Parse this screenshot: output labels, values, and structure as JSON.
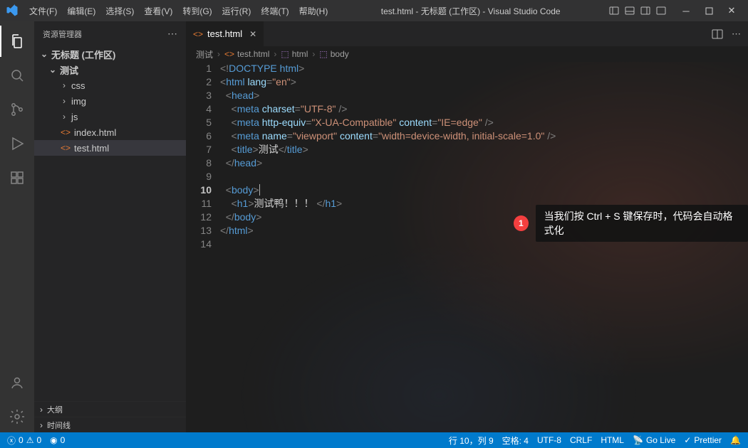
{
  "title": "test.html - 无标题 (工作区) - Visual Studio Code",
  "menu": [
    "文件(F)",
    "编辑(E)",
    "选择(S)",
    "查看(V)",
    "转到(G)",
    "运行(R)",
    "终端(T)",
    "帮助(H)"
  ],
  "sidebar": {
    "header": "资源管理器",
    "root": "无标题 (工作区)",
    "folder": "测试",
    "items": [
      {
        "kind": "folder",
        "label": "css"
      },
      {
        "kind": "folder",
        "label": "img"
      },
      {
        "kind": "folder",
        "label": "js"
      },
      {
        "kind": "file",
        "label": "index.html",
        "icon": "<>"
      },
      {
        "kind": "file",
        "label": "test.html",
        "icon": "<>",
        "selected": true
      }
    ],
    "outline": "大纲",
    "timeline": "时间线"
  },
  "tab": {
    "name": "test.html"
  },
  "breadcrumb": [
    "测试",
    "test.html",
    "html",
    "body"
  ],
  "code": {
    "lines": [
      {
        "n": 1,
        "seg": [
          [
            "<!",
            "tok-doctype"
          ],
          [
            "DOCTYPE ",
            "tok-doctype2"
          ],
          [
            "html",
            "tok-doctype2"
          ],
          [
            ">",
            "tok-doctype"
          ]
        ]
      },
      {
        "n": 2,
        "seg": [
          [
            "<",
            "tok-pun"
          ],
          [
            "html ",
            "tok-tag"
          ],
          [
            "lang",
            "tok-attr"
          ],
          [
            "=",
            "tok-pun"
          ],
          [
            "\"en\"",
            "tok-str"
          ],
          [
            ">",
            "tok-pun"
          ]
        ]
      },
      {
        "n": 3,
        "seg": [
          [
            "  <",
            "tok-pun"
          ],
          [
            "head",
            "tok-tag"
          ],
          [
            ">",
            "tok-pun"
          ]
        ]
      },
      {
        "n": 4,
        "seg": [
          [
            "    <",
            "tok-pun"
          ],
          [
            "meta ",
            "tok-tag"
          ],
          [
            "charset",
            "tok-attr"
          ],
          [
            "=",
            "tok-pun"
          ],
          [
            "\"UTF-8\"",
            "tok-str"
          ],
          [
            " />",
            "tok-pun"
          ]
        ]
      },
      {
        "n": 5,
        "seg": [
          [
            "    <",
            "tok-pun"
          ],
          [
            "meta ",
            "tok-tag"
          ],
          [
            "http-equiv",
            "tok-attr"
          ],
          [
            "=",
            "tok-pun"
          ],
          [
            "\"X-UA-Compatible\"",
            "tok-str"
          ],
          [
            " ",
            "tok-txt"
          ],
          [
            "content",
            "tok-attr"
          ],
          [
            "=",
            "tok-pun"
          ],
          [
            "\"IE=edge\"",
            "tok-str"
          ],
          [
            " />",
            "tok-pun"
          ]
        ]
      },
      {
        "n": 6,
        "seg": [
          [
            "    <",
            "tok-pun"
          ],
          [
            "meta ",
            "tok-tag"
          ],
          [
            "name",
            "tok-attr"
          ],
          [
            "=",
            "tok-pun"
          ],
          [
            "\"viewport\"",
            "tok-str"
          ],
          [
            " ",
            "tok-txt"
          ],
          [
            "content",
            "tok-attr"
          ],
          [
            "=",
            "tok-pun"
          ],
          [
            "\"width=device-width, initial-scale=1.0\"",
            "tok-str"
          ],
          [
            " />",
            "tok-pun"
          ]
        ]
      },
      {
        "n": 7,
        "seg": [
          [
            "    <",
            "tok-pun"
          ],
          [
            "title",
            "tok-tag"
          ],
          [
            ">",
            "tok-pun"
          ],
          [
            "测试",
            "tok-txt"
          ],
          [
            "</",
            "tok-pun"
          ],
          [
            "title",
            "tok-tag"
          ],
          [
            ">",
            "tok-pun"
          ]
        ]
      },
      {
        "n": 8,
        "seg": [
          [
            "  </",
            "tok-pun"
          ],
          [
            "head",
            "tok-tag"
          ],
          [
            ">",
            "tok-pun"
          ]
        ]
      },
      {
        "n": 9,
        "seg": [
          [
            "",
            "tok-txt"
          ]
        ]
      },
      {
        "n": 10,
        "cur": true,
        "seg": [
          [
            "  <",
            "tok-pun"
          ],
          [
            "body",
            "tok-tag"
          ],
          [
            ">",
            "tok-pun"
          ]
        ],
        "cursor": true
      },
      {
        "n": 11,
        "seg": [
          [
            "    <",
            "tok-pun"
          ],
          [
            "h1",
            "tok-tag"
          ],
          [
            ">",
            "tok-pun"
          ],
          [
            "测试鸭！！！ ",
            "tok-txt"
          ],
          [
            "</",
            "tok-pun"
          ],
          [
            "h1",
            "tok-tag"
          ],
          [
            ">",
            "tok-pun"
          ]
        ]
      },
      {
        "n": 12,
        "seg": [
          [
            "  </",
            "tok-pun"
          ],
          [
            "body",
            "tok-tag"
          ],
          [
            ">",
            "tok-pun"
          ]
        ]
      },
      {
        "n": 13,
        "seg": [
          [
            "</",
            "tok-pun"
          ],
          [
            "html",
            "tok-tag"
          ],
          [
            ">",
            "tok-pun"
          ]
        ]
      },
      {
        "n": 14,
        "seg": [
          [
            "",
            "tok-txt"
          ]
        ]
      }
    ]
  },
  "annotation": {
    "num": "1",
    "text": "当我们按 Ctrl + S 键保存时，代码会自动格式化"
  },
  "status": {
    "errors": "0",
    "warnings": "0",
    "ports": "0",
    "pos": "行 10，列 9",
    "spaces": "空格: 4",
    "enc": "UTF-8",
    "eol": "CRLF",
    "lang": "HTML",
    "live": "Go Live",
    "prettier": "Prettier"
  }
}
